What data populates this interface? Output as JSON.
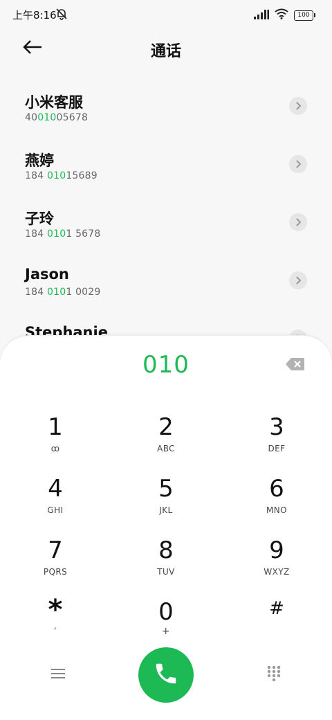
{
  "status_bar": {
    "time": "上午8:16",
    "battery": "100"
  },
  "header": {
    "title": "通话"
  },
  "contacts": [
    {
      "name": "小米客服",
      "number_pre": "40",
      "number_match": "010",
      "number_post": "05678"
    },
    {
      "name": "燕婷",
      "number_pre": "184 ",
      "number_match": "010",
      "number_post": "15689"
    },
    {
      "name": "子玲",
      "number_pre": "184 ",
      "number_match": "010",
      "number_post": "1 5678"
    },
    {
      "name": "Jason",
      "number_pre": "184 ",
      "number_match": "010",
      "number_post": "1 0029"
    },
    {
      "name": "Stephanie",
      "number_pre": "",
      "number_match": "",
      "number_post": ""
    }
  ],
  "dialer": {
    "input": "010"
  },
  "keys": [
    {
      "digit": "1",
      "letters": "ꝏ"
    },
    {
      "digit": "2",
      "letters": "ABC"
    },
    {
      "digit": "3",
      "letters": "DEF"
    },
    {
      "digit": "4",
      "letters": "GHI"
    },
    {
      "digit": "5",
      "letters": "JKL"
    },
    {
      "digit": "6",
      "letters": "MNO"
    },
    {
      "digit": "7",
      "letters": "PQRS"
    },
    {
      "digit": "8",
      "letters": "TUV"
    },
    {
      "digit": "9",
      "letters": "WXYZ"
    },
    {
      "digit": "*",
      "letters": ","
    },
    {
      "digit": "0",
      "letters": "+"
    },
    {
      "digit": "#",
      "letters": ""
    }
  ],
  "colors": {
    "accent": "#1db954",
    "text": "#111111",
    "secondary": "#666666"
  },
  "icons": {
    "back": "arrow-left-icon",
    "mute": "bell-off-icon",
    "signal": "signal-icon",
    "wifi": "wifi-icon",
    "detail": "chevron-right-icon",
    "backspace": "backspace-icon",
    "menu": "menu-icon",
    "call": "phone-icon",
    "keypad": "dialpad-icon"
  }
}
